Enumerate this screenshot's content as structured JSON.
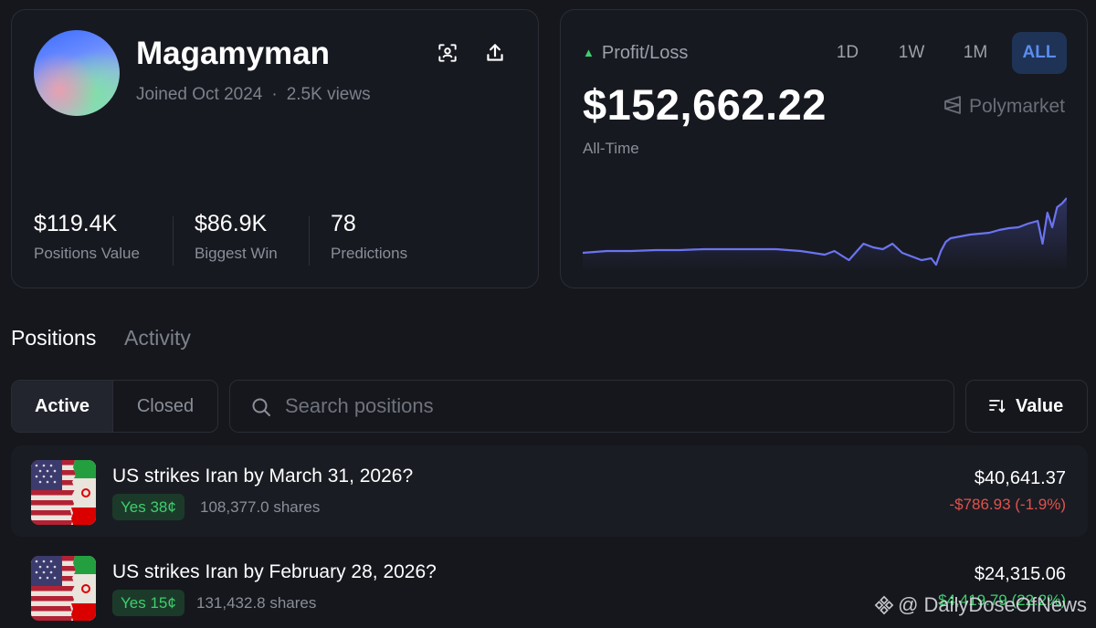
{
  "profile": {
    "username": "Magamyman",
    "joined": "Joined Oct 2024",
    "views": "2.5K views",
    "stats": [
      {
        "value": "$119.4K",
        "label": "Positions Value"
      },
      {
        "value": "$86.9K",
        "label": "Biggest Win"
      },
      {
        "value": "78",
        "label": "Predictions"
      }
    ]
  },
  "pnl": {
    "label": "Profit/Loss",
    "timeframes": [
      "1D",
      "1W",
      "1M",
      "ALL"
    ],
    "active_timeframe": "ALL",
    "value": "$152,662.22",
    "period": "All-Time",
    "brand": "Polymarket",
    "accent_color": "#6b74f0"
  },
  "chart_data": {
    "type": "area",
    "x": [
      0,
      5,
      10,
      15,
      20,
      25,
      30,
      35,
      40,
      45,
      50,
      52,
      55,
      57,
      58,
      60,
      62,
      64,
      66,
      68,
      70,
      72,
      73,
      74,
      75,
      76,
      78,
      80,
      82,
      84,
      86,
      88,
      90,
      92,
      94,
      95,
      96,
      97,
      98,
      99,
      100
    ],
    "values": [
      0.2,
      0.22,
      0.22,
      0.23,
      0.23,
      0.24,
      0.24,
      0.24,
      0.24,
      0.22,
      0.18,
      0.22,
      0.12,
      0.24,
      0.3,
      0.26,
      0.24,
      0.3,
      0.2,
      0.16,
      0.12,
      0.14,
      0.07,
      0.22,
      0.32,
      0.36,
      0.38,
      0.4,
      0.41,
      0.42,
      0.45,
      0.47,
      0.48,
      0.52,
      0.55,
      0.3,
      0.64,
      0.48,
      0.7,
      0.74,
      0.8
    ]
  },
  "tabs": {
    "positions": "Positions",
    "activity": "Activity"
  },
  "filters": {
    "active": "Active",
    "closed": "Closed"
  },
  "search": {
    "placeholder": "Search positions"
  },
  "sort": {
    "label": "Value"
  },
  "positions": [
    {
      "title": "US strikes Iran by March 31, 2026?",
      "outcome": "Yes 38¢",
      "shares": "108,377.0 shares",
      "value": "$40,641.37",
      "change": "-$786.93 (-1.9%)",
      "change_color": "negative"
    },
    {
      "title": "US strikes Iran by February 28, 2026?",
      "outcome": "Yes 15¢",
      "shares": "131,432.8 shares",
      "value": "$24,315.06",
      "change": "$4,419.79 (22.2%)",
      "change_color": "positive"
    }
  ],
  "watermark": "@ DailyDoseOfNews"
}
